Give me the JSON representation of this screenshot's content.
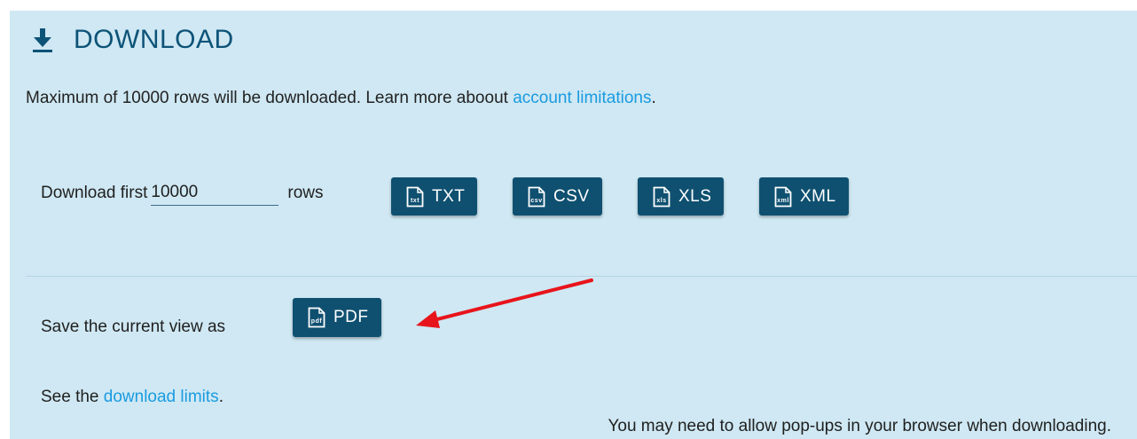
{
  "header": {
    "title": "DOWNLOAD",
    "icon": "download-icon"
  },
  "notice": {
    "text": "Maximum of 10000 rows will be downloaded. Learn more aboout ",
    "link": "account limitations",
    "suffix": "."
  },
  "download_rows": {
    "prefix": "Download first",
    "value": "10000",
    "suffix": "rows"
  },
  "buttons": [
    {
      "label": "TXT",
      "icon": "txt-file-icon",
      "icon_text": "txt"
    },
    {
      "label": "CSV",
      "icon": "csv-file-icon",
      "icon_text": "csv"
    },
    {
      "label": "XLS",
      "icon": "xls-file-icon",
      "icon_text": "xls"
    },
    {
      "label": "XML",
      "icon": "xml-file-icon",
      "icon_text": "xml"
    }
  ],
  "save_view": {
    "label": "Save the current view as",
    "button_label": "PDF",
    "button_icon": "pdf-file-icon",
    "icon_text": "pdf"
  },
  "limits": {
    "prefix": "See the ",
    "link": "download limits",
    "suffix": "."
  },
  "popups_note": "You may need to allow pop-ups in your browser when downloading.",
  "colors": {
    "panel_bg": "#cfe8f3",
    "button_bg": "#0f5070",
    "title": "#0d5378",
    "link": "#1a9be0",
    "annotation_arrow": "#e8141b"
  }
}
